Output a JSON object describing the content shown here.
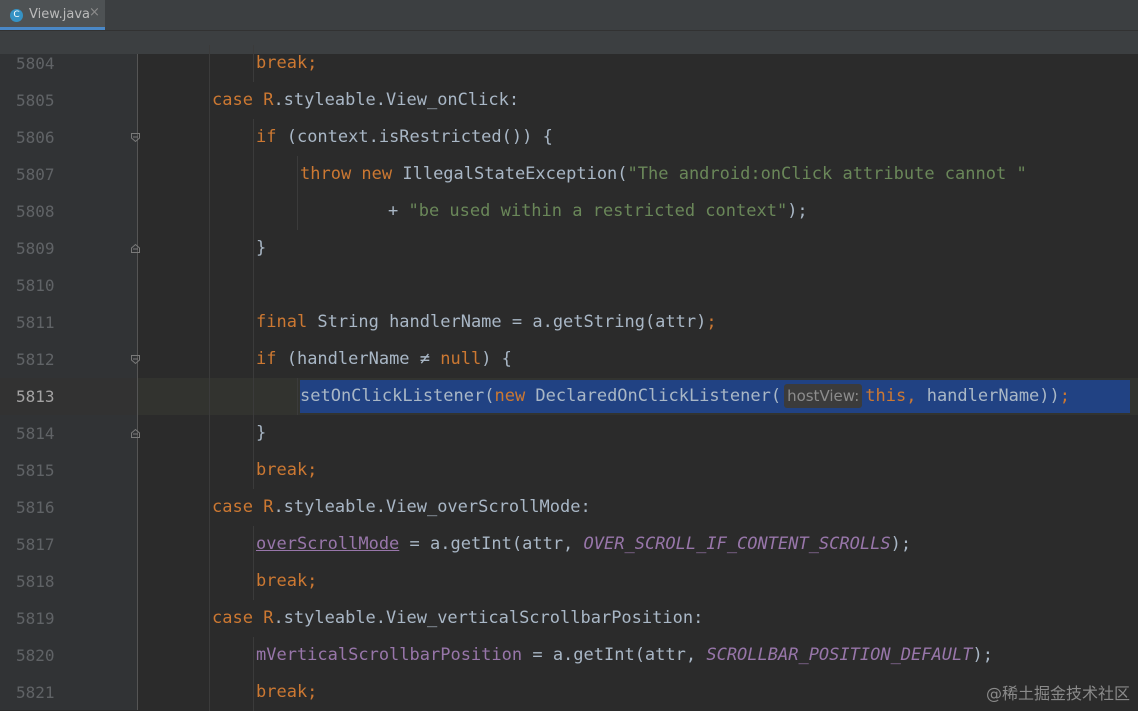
{
  "tab": {
    "icon_letter": "C",
    "icon_name": "class-icon",
    "title": "View.java",
    "close": "×"
  },
  "lines": [
    {
      "num": "5804",
      "indent": 2,
      "code": [
        {
          "t": "break;",
          "c": "kw"
        }
      ]
    },
    {
      "num": "5805",
      "indent": 1,
      "code": [
        {
          "t": "case ",
          "c": "kw"
        },
        {
          "t": "R",
          "c": "rcls"
        },
        {
          "t": ".styleable.View_onClick:",
          "c": ""
        }
      ]
    },
    {
      "num": "5806",
      "indent": 2,
      "fold": "open",
      "code": [
        {
          "t": "if ",
          "c": "kw"
        },
        {
          "t": "(context.isRestricted()) {",
          "c": ""
        }
      ]
    },
    {
      "num": "5807",
      "indent": 3,
      "code": [
        {
          "t": "throw new ",
          "c": "kw"
        },
        {
          "t": "IllegalStateException(",
          "c": ""
        },
        {
          "t": "\"The android:onClick attribute cannot \"",
          "c": "str"
        }
      ]
    },
    {
      "num": "5808",
      "indent": 5,
      "code": [
        {
          "t": "+ ",
          "c": ""
        },
        {
          "t": "\"be used within a restricted context\"",
          "c": "str"
        },
        {
          "t": ");",
          "c": ""
        }
      ]
    },
    {
      "num": "5809",
      "indent": 2,
      "fold": "close",
      "code": [
        {
          "t": "}",
          "c": ""
        }
      ]
    },
    {
      "num": "5810",
      "indent": 2,
      "code": []
    },
    {
      "num": "5811",
      "indent": 2,
      "code": [
        {
          "t": "final ",
          "c": "kw"
        },
        {
          "t": "String handlerName = a.getString(attr)",
          "c": ""
        },
        {
          "t": ";",
          "c": "kw"
        }
      ]
    },
    {
      "num": "5812",
      "indent": 2,
      "fold": "open",
      "code": [
        {
          "t": "if ",
          "c": "kw"
        },
        {
          "t": "(handlerName ≠ ",
          "c": ""
        },
        {
          "t": "null",
          "c": "kw"
        },
        {
          "t": ") {",
          "c": ""
        }
      ]
    },
    {
      "num": "5813",
      "indent": 3,
      "current": true,
      "code": [
        {
          "t": "setOnClickListener(",
          "c": ""
        },
        {
          "t": "new ",
          "c": "kw"
        },
        {
          "t": "DeclaredOnClickListener(",
          "c": ""
        },
        {
          "hint": "hostView:"
        },
        {
          "t": "this, ",
          "c": "kw"
        },
        {
          "t": "handlerName))",
          "c": ""
        },
        {
          "t": ";",
          "c": "kw"
        }
      ]
    },
    {
      "num": "5814",
      "indent": 2,
      "fold": "close",
      "code": [
        {
          "t": "}",
          "c": ""
        }
      ]
    },
    {
      "num": "5815",
      "indent": 2,
      "code": [
        {
          "t": "break;",
          "c": "kw"
        }
      ]
    },
    {
      "num": "5816",
      "indent": 1,
      "code": [
        {
          "t": "case ",
          "c": "kw"
        },
        {
          "t": "R",
          "c": "rcls"
        },
        {
          "t": ".styleable.View_overScrollMode:",
          "c": ""
        }
      ]
    },
    {
      "num": "5817",
      "indent": 2,
      "code": [
        {
          "t": "overScrollMode",
          "c": "fld ul"
        },
        {
          "t": " = a.getInt(attr, ",
          "c": ""
        },
        {
          "t": "OVER_SCROLL_IF_CONTENT_SCROLLS",
          "c": "cst"
        },
        {
          "t": ");",
          "c": ""
        }
      ]
    },
    {
      "num": "5818",
      "indent": 2,
      "code": [
        {
          "t": "break;",
          "c": "kw"
        }
      ]
    },
    {
      "num": "5819",
      "indent": 1,
      "code": [
        {
          "t": "case ",
          "c": "kw"
        },
        {
          "t": "R",
          "c": "rcls"
        },
        {
          "t": ".styleable.View_verticalScrollbarPosition:",
          "c": ""
        }
      ]
    },
    {
      "num": "5820",
      "indent": 2,
      "code": [
        {
          "t": "mVerticalScrollbarPosition",
          "c": "fld"
        },
        {
          "t": " = a.getInt(attr, ",
          "c": ""
        },
        {
          "t": "SCROLLBAR_POSITION_DEFAULT",
          "c": "cst"
        },
        {
          "t": ");",
          "c": ""
        }
      ]
    },
    {
      "num": "5821",
      "indent": 2,
      "code": [
        {
          "t": "break;",
          "c": "kw"
        }
      ]
    }
  ],
  "watermark": "@稀土掘金技术社区",
  "colors": {
    "keyword": "#cc7832",
    "string": "#6a8759",
    "field": "#9876aa",
    "text": "#a9b7c6",
    "selection": "#214283",
    "background": "#2b2b2b",
    "gutter": "#313335",
    "tab_accent": "#4a88c7"
  }
}
